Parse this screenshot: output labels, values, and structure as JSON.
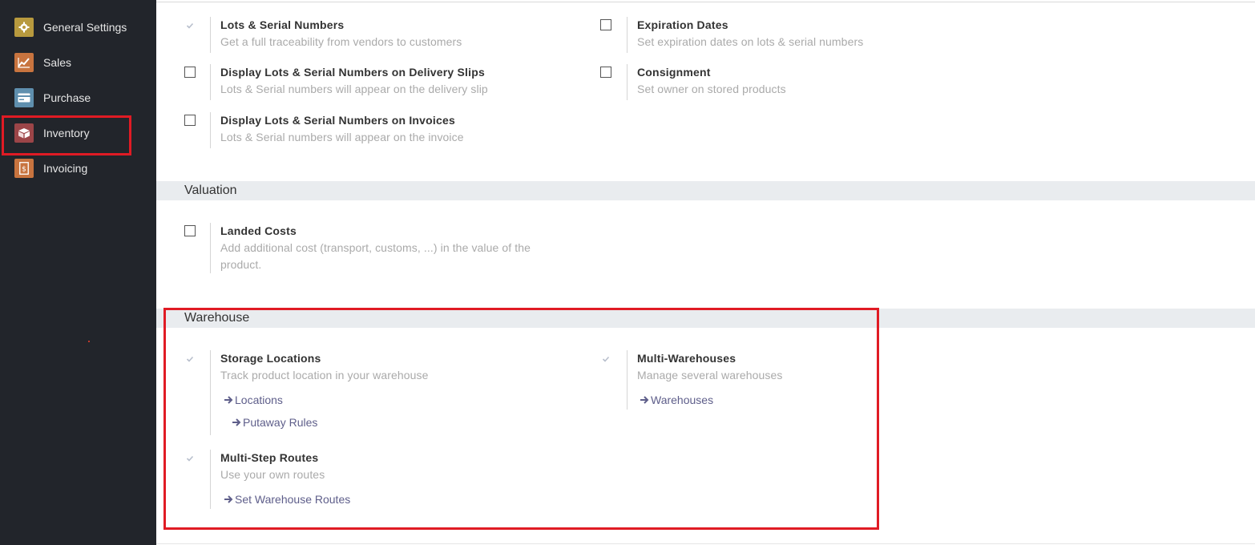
{
  "sidebar": {
    "items": [
      {
        "label": "General Settings",
        "icon": "gear-icon",
        "color": "#b89a3e"
      },
      {
        "label": "Sales",
        "icon": "chart-line-icon",
        "color": "#c8743f"
      },
      {
        "label": "Purchase",
        "icon": "credit-card-icon",
        "color": "#5f8fae"
      },
      {
        "label": "Inventory",
        "icon": "box-icon",
        "color": "#9c4548"
      },
      {
        "label": "Invoicing",
        "icon": "invoice-icon",
        "color": "#c8743f"
      }
    ]
  },
  "traceability": {
    "lots": {
      "title": "Lots & Serial Numbers",
      "desc": "Get a full traceability from vendors to customers",
      "checked": true
    },
    "expiration": {
      "title": "Expiration Dates",
      "desc": "Set expiration dates on lots & serial numbers",
      "checked": false
    },
    "delivery_slips": {
      "title": "Display Lots & Serial Numbers on Delivery Slips",
      "desc": "Lots & Serial numbers will appear on the delivery slip",
      "checked": false
    },
    "consignment": {
      "title": "Consignment",
      "desc": "Set owner on stored products",
      "checked": false
    },
    "invoices": {
      "title": "Display Lots & Serial Numbers on Invoices",
      "desc": "Lots & Serial numbers will appear on the invoice",
      "checked": false
    }
  },
  "valuation": {
    "title": "Valuation",
    "landed_costs": {
      "title": "Landed Costs",
      "desc_line1": "Add additional cost (transport, customs, ...) in the value of the",
      "desc_line2": "product.",
      "checked": false
    }
  },
  "warehouse": {
    "title": "Warehouse",
    "storage": {
      "title": "Storage Locations",
      "desc": "Track product location in your warehouse",
      "link1": "Locations",
      "link2": "Putaway Rules",
      "checked": true
    },
    "multi_wh": {
      "title": "Multi-Warehouses",
      "desc": "Manage several warehouses",
      "link1": "Warehouses",
      "checked": true
    },
    "routes": {
      "title": "Multi-Step Routes",
      "desc": "Use your own routes",
      "link1": "Set Warehouse Routes",
      "checked": true
    }
  },
  "colors": {
    "highlight": "#e01b24",
    "link": "#5e5e8a",
    "checkbox_disabled": "#b8bfcc"
  }
}
